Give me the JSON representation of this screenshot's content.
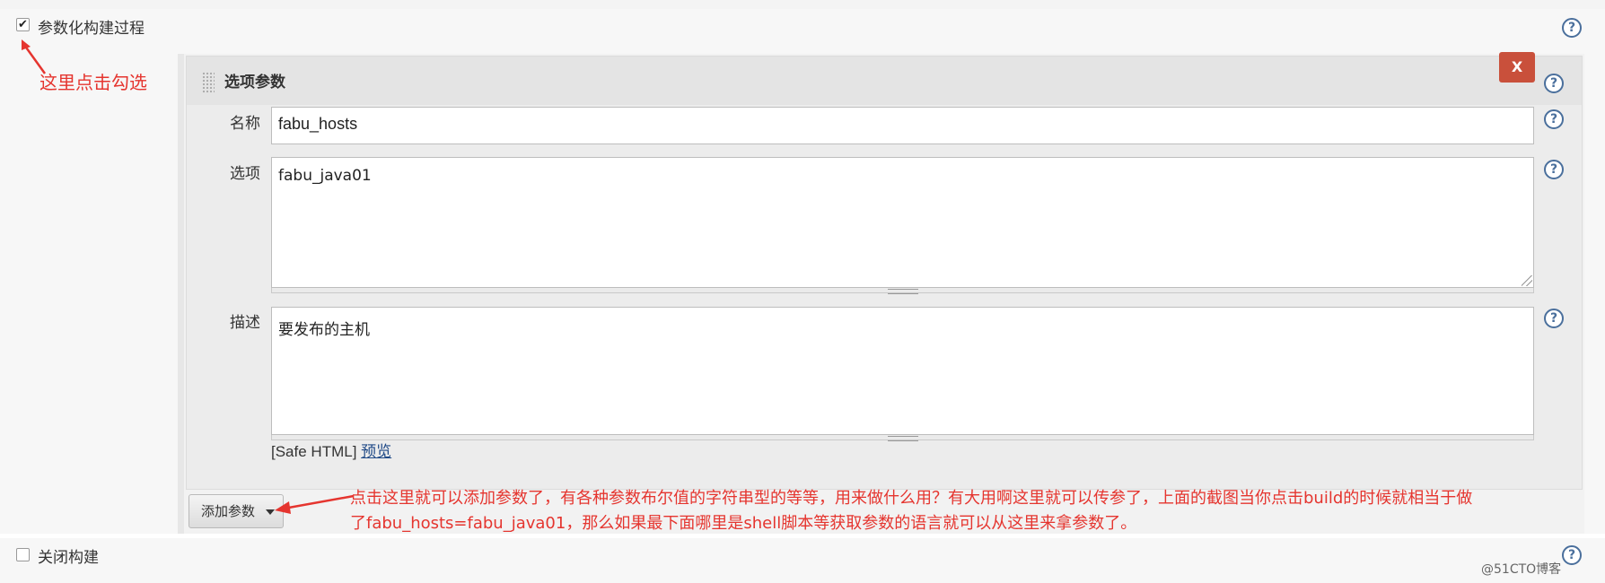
{
  "param_build": {
    "checked_glyph": "✔",
    "label": "参数化构建过程"
  },
  "annotations": {
    "check_hint": "这里点击勾选",
    "add_param_hint_line1": "点击这里就可以添加参数了，有各种参数布尔值的字符串型的等等，用来做什么用？有大用啊这里就可以传参了，上面的截图当你点击build的时候就相当于做",
    "add_param_hint_line2": "了fabu_hosts=fabu_java01，那么如果最下面哪里是shell脚本等获取参数的语言就可以从这里来拿参数了。",
    "arrow_color": "#e5352f"
  },
  "choice_param": {
    "title": "选项参数",
    "delete_label": "X",
    "name_label": "名称",
    "name_value": "fabu_hosts",
    "choices_label": "选项",
    "choices_value": "fabu_java01",
    "description_label": "描述",
    "description_value": "要发布的主机",
    "safe_html_prefix": "[Safe HTML]",
    "preview_link": "预览"
  },
  "add_param_button": {
    "label": "添加参数",
    "icon": "caret-down-icon"
  },
  "disable_build": {
    "checked": false,
    "label": "关闭构建"
  },
  "help_icon": {
    "glyph": "?",
    "color": "#4a6f9c"
  },
  "watermark": "@51CTO博客",
  "colors": {
    "delete_button": "#c9503b",
    "annotation": "#e5352f",
    "link": "#204a87"
  }
}
